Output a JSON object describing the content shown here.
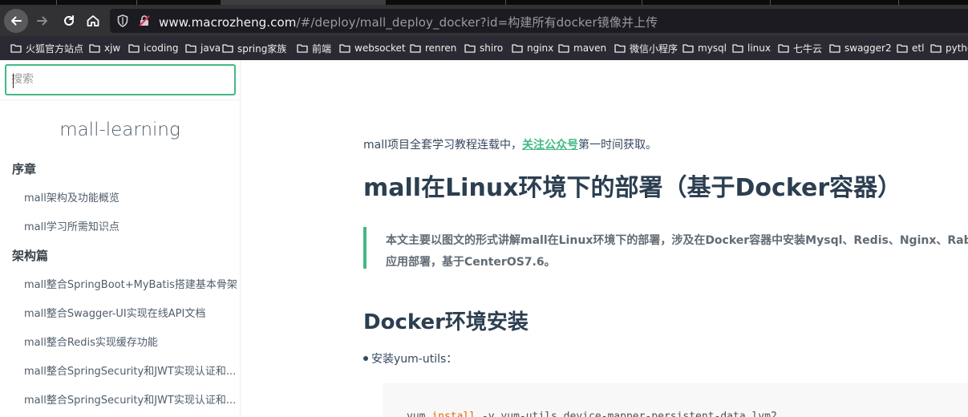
{
  "browser": {
    "url_host": "www.macrozheng.com",
    "url_path": "/#/deploy/mall_deploy_docker?id=构建所有docker镜像并上传",
    "bookmarks": [
      "火狐官方站点",
      "xjw",
      "icoding",
      "java",
      "spring家族",
      "前端",
      "websocket",
      "renren",
      "shiro",
      "nginx",
      "maven",
      "微信小程序",
      "mysql",
      "linux",
      "七牛云",
      "swagger2",
      "etl",
      "python"
    ]
  },
  "sidebar": {
    "search_placeholder": "搜索",
    "app_name": "mall-learning",
    "sections": [
      {
        "title": "序章",
        "items": [
          "mall架构及功能概览",
          "mall学习所需知识点"
        ]
      },
      {
        "title": "架构篇",
        "items": [
          "mall整合SpringBoot+MyBatis搭建基本骨架",
          "mall整合Swagger-UI实现在线API文档",
          "mall整合Redis实现缓存功能",
          "mall整合SpringSecurity和JWT实现认证和...",
          "mall整合SpringSecurity和JWT实现认证和..."
        ]
      }
    ]
  },
  "content": {
    "intro_prefix": "mall项目全套学习教程连载中，",
    "intro_link": "关注公众号",
    "intro_suffix": "第一时间获取。",
    "title": "mall在Linux环境下的部署（基于Docker容器）",
    "quote_line1": "本文主要以图文的形式讲解mall在Linux环境下的部署，涉及在Docker容器中安装Mysql、Redis、Nginx、RabbitMQ",
    "quote_line2": "应用部署，基于CenterOS7.6。",
    "section_title": "Docker环境安装",
    "bullet": "安装yum-utils：",
    "code_prefix": "yum ",
    "code_keyword": "install",
    "code_suffix": " -y yum-utils device-mapper-persistent-data lvm2"
  },
  "colors": {
    "accent": "#42b983",
    "heading": "#2c3e50",
    "chrome": "#323234"
  }
}
